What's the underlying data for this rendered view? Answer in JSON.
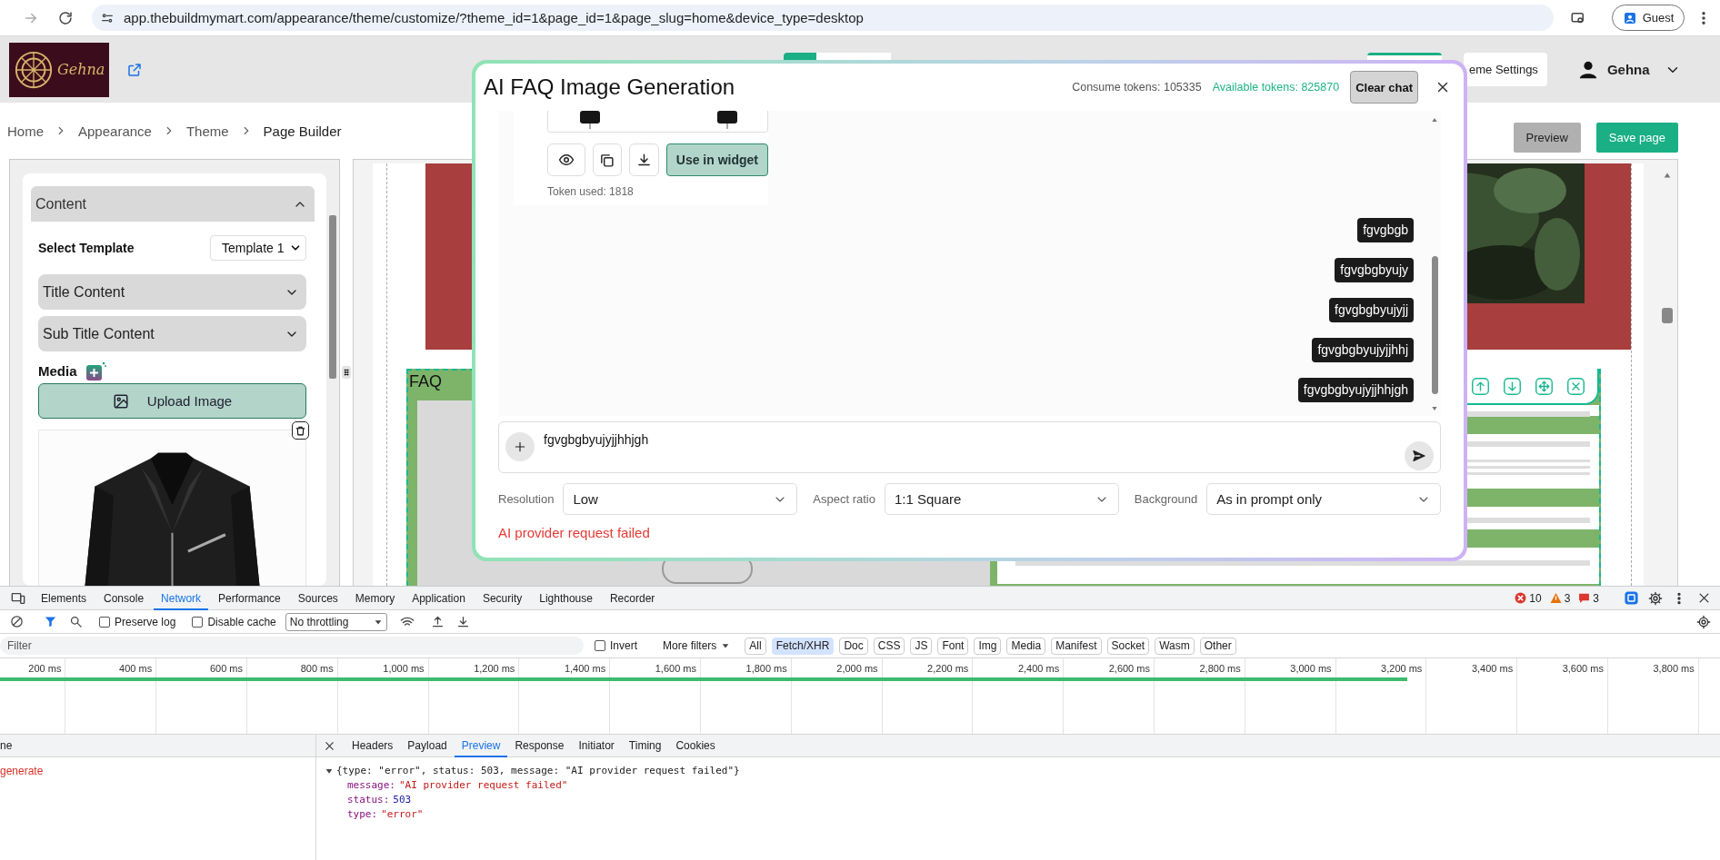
{
  "browser": {
    "url": "app.thebuildmymart.com/appearance/theme/customize/?theme_id=1&page_id=1&page_slug=home&device_type=desktop",
    "profile": "Guest"
  },
  "header": {
    "logo_text": "Gehna",
    "view_switch": [
      {
        "selected": true
      },
      {
        "selected": false
      }
    ],
    "settings_button": "eme Settings",
    "user": "Gehna"
  },
  "breadcrumb": [
    "Home",
    "Appearance",
    "Theme",
    "Page Builder"
  ],
  "actions": [
    {
      "label": "Preview",
      "kind": "secondary"
    },
    {
      "label": "Save page",
      "kind": "primary"
    }
  ],
  "panel": {
    "section": {
      "title": "Content",
      "expanded": true
    },
    "template": {
      "label": "Select Template",
      "value": "Template 1"
    },
    "subsections": [
      {
        "title": "Title Content",
        "expanded": false
      },
      {
        "title": "Sub Title Content",
        "expanded": false
      }
    ],
    "media_label": "Media",
    "upload_button": "Upload Image"
  },
  "canvas": {
    "section_label": "FAQ"
  },
  "modal": {
    "title": "AI FAQ Image Generation",
    "consumed": "Consume tokens: 105335",
    "available": "Available tokens: 825870",
    "clear_button": "Clear chat",
    "result": {
      "action": "Use in widget",
      "tokens": "Token used: 1818"
    },
    "messages": [
      "fgvgbgb",
      "fgvgbgbyujy",
      "fgvgbgbyujyjj",
      "fgvgbgbyujyjjhhj",
      "fgvgbgbyujyjjhhjgh"
    ],
    "prompt": {
      "value": "fgvgbgbyujyjjhhjgh"
    },
    "options": [
      {
        "label": "Resolution",
        "value": "Low"
      },
      {
        "label": "Aspect ratio",
        "value": "1:1 Square"
      },
      {
        "label": "Background",
        "value": "As in prompt only"
      }
    ],
    "error": "AI provider request failed"
  },
  "devtools": {
    "tabs": [
      {
        "label": "Elements",
        "selected": false
      },
      {
        "label": "Console",
        "selected": false
      },
      {
        "label": "Network",
        "selected": true
      },
      {
        "label": "Performance",
        "selected": false
      },
      {
        "label": "Sources",
        "selected": false
      },
      {
        "label": "Memory",
        "selected": false
      },
      {
        "label": "Application",
        "selected": false
      },
      {
        "label": "Security",
        "selected": false
      },
      {
        "label": "Lighthouse",
        "selected": false
      },
      {
        "label": "Recorder",
        "selected": false
      }
    ],
    "counts": {
      "errors": "10",
      "warnings": "3",
      "issues": "3"
    },
    "preserve_log": {
      "label": "Preserve log",
      "checked": false
    },
    "disable_cache": {
      "label": "Disable cache",
      "checked": false
    },
    "throttling": "No throttling",
    "filter": {
      "placeholder": "Filter",
      "invert": {
        "label": "Invert",
        "checked": false
      },
      "more": "More filters",
      "types": [
        {
          "label": "All",
          "selected": false
        },
        {
          "label": "Fetch/XHR",
          "selected": true
        },
        {
          "label": "Doc",
          "selected": false
        },
        {
          "label": "CSS",
          "selected": false
        },
        {
          "label": "JS",
          "selected": false
        },
        {
          "label": "Font",
          "selected": false
        },
        {
          "label": "Img",
          "selected": false
        },
        {
          "label": "Media",
          "selected": false
        },
        {
          "label": "Manifest",
          "selected": false
        },
        {
          "label": "Socket",
          "selected": false
        },
        {
          "label": "Wasm",
          "selected": false
        },
        {
          "label": "Other",
          "selected": false
        }
      ]
    },
    "ticks": [
      "200 ms",
      "400 ms",
      "600 ms",
      "800 ms",
      "1,000 ms",
      "1,200 ms",
      "1,400 ms",
      "1,600 ms",
      "1,800 ms",
      "2,000 ms",
      "2,200 ms",
      "2,400 ms",
      "2,600 ms",
      "2,800 ms",
      "3,000 ms",
      "3,200 ms",
      "3,400 ms",
      "3,600 ms",
      "3,800 ms"
    ],
    "requests": {
      "header": "ne",
      "rows": [
        {
          "name": "generate",
          "failed": true
        }
      ]
    },
    "detail_tabs": [
      {
        "label": "Headers",
        "selected": false
      },
      {
        "label": "Payload",
        "selected": false
      },
      {
        "label": "Preview",
        "selected": true
      },
      {
        "label": "Response",
        "selected": false
      },
      {
        "label": "Initiator",
        "selected": false
      },
      {
        "label": "Timing",
        "selected": false
      },
      {
        "label": "Cookies",
        "selected": false
      }
    ],
    "preview": {
      "expanded": true,
      "summary": "{type: \"error\", status: 503, message: \"AI provider request failed\"}",
      "fields": [
        {
          "key": "message:",
          "value": "\"AI provider request failed\"",
          "kind": "string"
        },
        {
          "key": "status:",
          "value": "503",
          "kind": "number"
        },
        {
          "key": "type:",
          "value": "\"error\"",
          "kind": "string"
        }
      ]
    }
  }
}
